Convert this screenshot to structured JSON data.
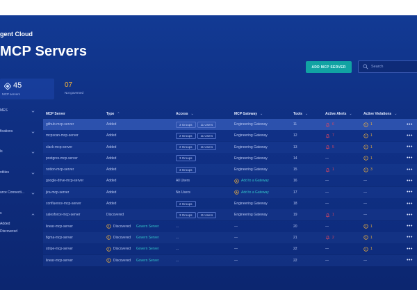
{
  "app": {
    "brand": "gent Cloud",
    "page_title": "MCP Servers"
  },
  "toolbar": {
    "add_label": "ADD MCP SERVER",
    "search_placeholder": "Search"
  },
  "stats": [
    {
      "value": "45",
      "label": "MCP servers"
    },
    {
      "value": "07",
      "label": "Not governed"
    }
  ],
  "sidebar": {
    "items": [
      {
        "label": "MES"
      },
      {
        "label": "fications"
      },
      {
        "label": "ls"
      },
      {
        "label": "ntities"
      },
      {
        "label": "urce Connecti..."
      },
      {
        "label": "s"
      }
    ],
    "subitems": [
      "Added",
      "Discovered"
    ]
  },
  "table": {
    "columns": [
      {
        "label": "MCP Server",
        "arrow": ""
      },
      {
        "label": "Type",
        "arrow": "⌃"
      },
      {
        "label": "Access",
        "arrow": "⌄"
      },
      {
        "label": "MCP Gateway",
        "arrow": "⌄"
      },
      {
        "label": "Tools",
        "arrow": "⌄"
      },
      {
        "label": "Active Alerts",
        "arrow": "⌄"
      },
      {
        "label": "Active Violations",
        "arrow": "⌄"
      },
      {
        "label": "",
        "arrow": ""
      }
    ],
    "rows": [
      {
        "name": "github-mcp-server",
        "type": "Added",
        "access_pills": [
          "3 Groups",
          "11 Users"
        ],
        "access_text": "",
        "gateway": "Engineering Gateway",
        "gateway_add": false,
        "tools": "11",
        "alerts": "6",
        "violations": "1",
        "selected": true,
        "discovered": false
      },
      {
        "name": "mcpscan-mcp-server",
        "type": "Added",
        "access_pills": [
          "2 Groups",
          "11 Users"
        ],
        "access_text": "",
        "gateway": "Engineering Gateway",
        "gateway_add": false,
        "tools": "12",
        "alerts": "7",
        "violations": "1",
        "selected": false,
        "discovered": false
      },
      {
        "name": "slack-mcp-server",
        "type": "Added",
        "access_pills": [
          "2 Groups",
          "11 Users"
        ],
        "access_text": "",
        "gateway": "Engineering Gateway",
        "gateway_add": false,
        "tools": "13",
        "alerts": "5",
        "violations": "1",
        "selected": false,
        "discovered": false
      },
      {
        "name": "postgres-mcp-server",
        "type": "Added",
        "access_pills": [
          "3 Groups"
        ],
        "access_text": "",
        "gateway": "Engineering Gateway",
        "gateway_add": false,
        "tools": "14",
        "alerts": "—",
        "violations": "1",
        "selected": false,
        "discovered": false
      },
      {
        "name": "notion-mcp-server",
        "type": "Added",
        "access_pills": [
          "3 Groups"
        ],
        "access_text": "",
        "gateway": "Engineering Gateway",
        "gateway_add": false,
        "tools": "15",
        "alerts": "1",
        "violations": "3",
        "selected": false,
        "discovered": false
      },
      {
        "name": "google-drive-mcp-server",
        "type": "Added",
        "access_pills": [],
        "access_text": "All Users",
        "gateway": "Add to a Gateway",
        "gateway_add": true,
        "tools": "16",
        "alerts": "—",
        "violations": "—",
        "selected": false,
        "discovered": false
      },
      {
        "name": "jira-mcp-server",
        "type": "Added",
        "access_pills": [],
        "access_text": "No Users",
        "gateway": "Add to a Gateway",
        "gateway_add": true,
        "tools": "17",
        "alerts": "—",
        "violations": "—",
        "selected": false,
        "discovered": false
      },
      {
        "name": "confluence-mcp-server",
        "type": "Added",
        "access_pills": [
          "2 Groups"
        ],
        "access_text": "",
        "gateway": "Engineering Gateway",
        "gateway_add": false,
        "tools": "18",
        "alerts": "—",
        "violations": "—",
        "selected": false,
        "discovered": false
      },
      {
        "name": "salesforce-mcp-server",
        "type": "Discovered",
        "access_pills": [
          "3 Groups",
          "11 Users"
        ],
        "access_text": "",
        "gateway": "Engineering Gateway",
        "gateway_add": false,
        "tools": "19",
        "alerts": "1",
        "violations": "—",
        "selected": false,
        "discovered": false
      },
      {
        "name": "linear-mcp-server",
        "type": "Discovered",
        "access_pills": [],
        "access_text": "...",
        "gateway": "—",
        "gateway_add": false,
        "tools": "20",
        "alerts": "—",
        "violations": "1",
        "selected": false,
        "discovered": true
      },
      {
        "name": "figma-mcp-server",
        "type": "Discovered",
        "access_pills": [],
        "access_text": "...",
        "gateway": "—",
        "gateway_add": false,
        "tools": "21",
        "alerts": "2",
        "violations": "1",
        "selected": false,
        "discovered": true
      },
      {
        "name": "stripe-mcp-server",
        "type": "Discovered",
        "access_pills": [],
        "access_text": "...",
        "gateway": "—",
        "gateway_add": false,
        "tools": "22",
        "alerts": "—",
        "violations": "1",
        "selected": false,
        "discovered": true
      },
      {
        "name": "linear-mcp-server",
        "type": "Discovered",
        "access_pills": [],
        "access_text": "...",
        "gateway": "—",
        "gateway_add": false,
        "tools": "22",
        "alerts": "—",
        "violations": "—",
        "selected": false,
        "discovered": true
      }
    ],
    "govern_label": "Govern Server",
    "more_label": "•••"
  },
  "colors": {
    "accent": "#11a3a3",
    "alert": "#e0455f",
    "warning": "#f2b13c",
    "link": "#33c3c9"
  }
}
